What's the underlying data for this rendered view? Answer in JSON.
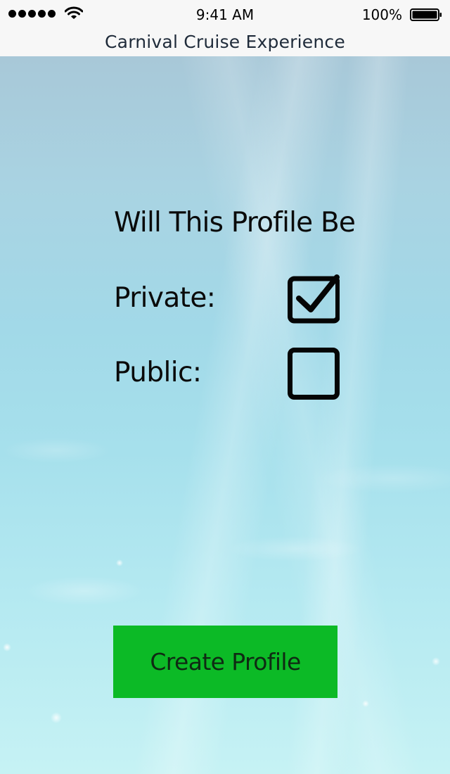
{
  "status_bar": {
    "time": "9:41 AM",
    "battery_percent": "100%",
    "signal_bars": 5,
    "icons": [
      "signal-dots-icon",
      "wifi-icon",
      "battery-icon"
    ]
  },
  "nav": {
    "title": "Carnival Cruise Experience"
  },
  "form": {
    "question": "Will This Profile Be",
    "options": [
      {
        "label": "Private:",
        "checked": true
      },
      {
        "label": "Public:",
        "checked": false
      }
    ]
  },
  "actions": {
    "create_label": "Create Profile"
  },
  "colors": {
    "button_bg": "#0cba26",
    "button_text": "#0f2a13",
    "bar_bg": "#f7f7f7",
    "title_text": "#1f2b3a"
  }
}
